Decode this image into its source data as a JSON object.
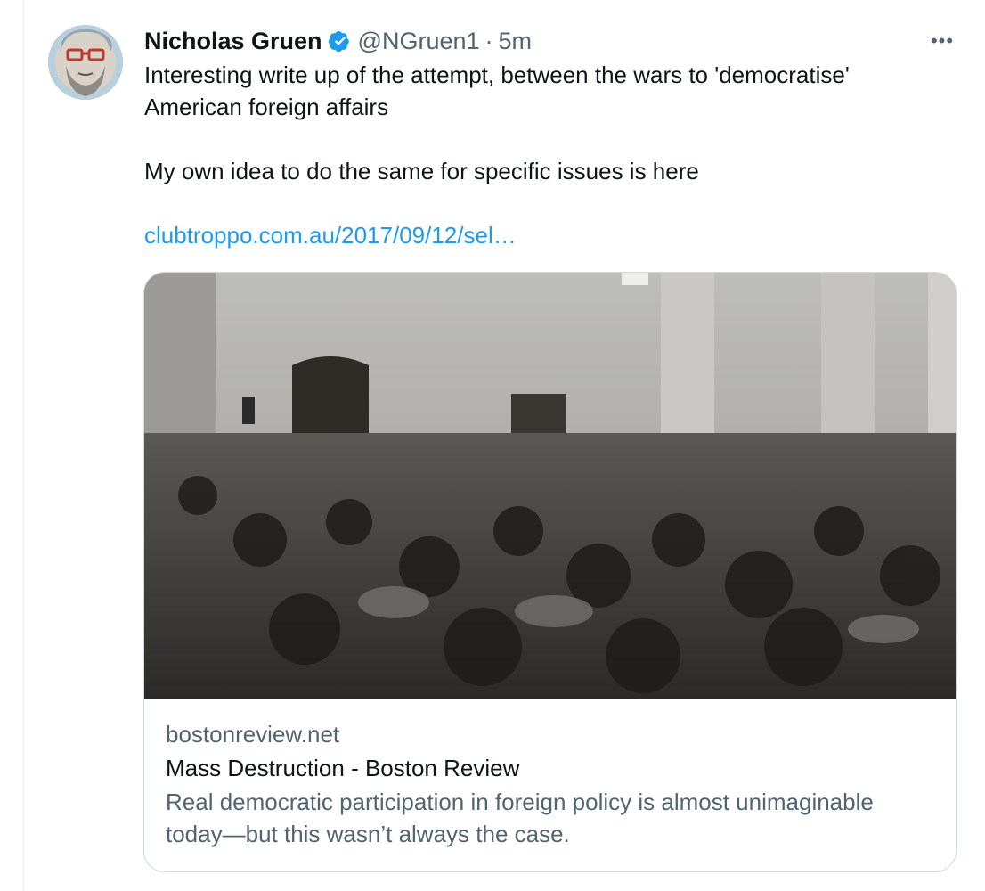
{
  "tweet": {
    "author": {
      "name": "Nicholas Gruen",
      "handle": "@NGruen1",
      "separator": "·",
      "time": "5m"
    },
    "more_label": "•••",
    "text": {
      "paragraph1_line1": "Interesting write up of the attempt, between the wars to 'democratise'",
      "paragraph1_line2": "American foreign affairs",
      "paragraph2": "My own idea to do the same for specific issues is here",
      "link": "clubtroppo.com.au/2017/09/12/sel…"
    },
    "card": {
      "domain": "bostonreview.net",
      "title": "Mass Destruction - Boston Review",
      "description_line1": "Real democratic participation in foreign policy is almost unimaginable",
      "description_line2": "today—but this wasn’t always the case."
    }
  },
  "icons": {
    "verified": "verified-badge-icon",
    "more": "more-options-icon"
  },
  "colors": {
    "link": "#1d9bf0",
    "secondary_text": "#536471",
    "border": "#cfd9de",
    "verified": "#1d9bf0"
  }
}
